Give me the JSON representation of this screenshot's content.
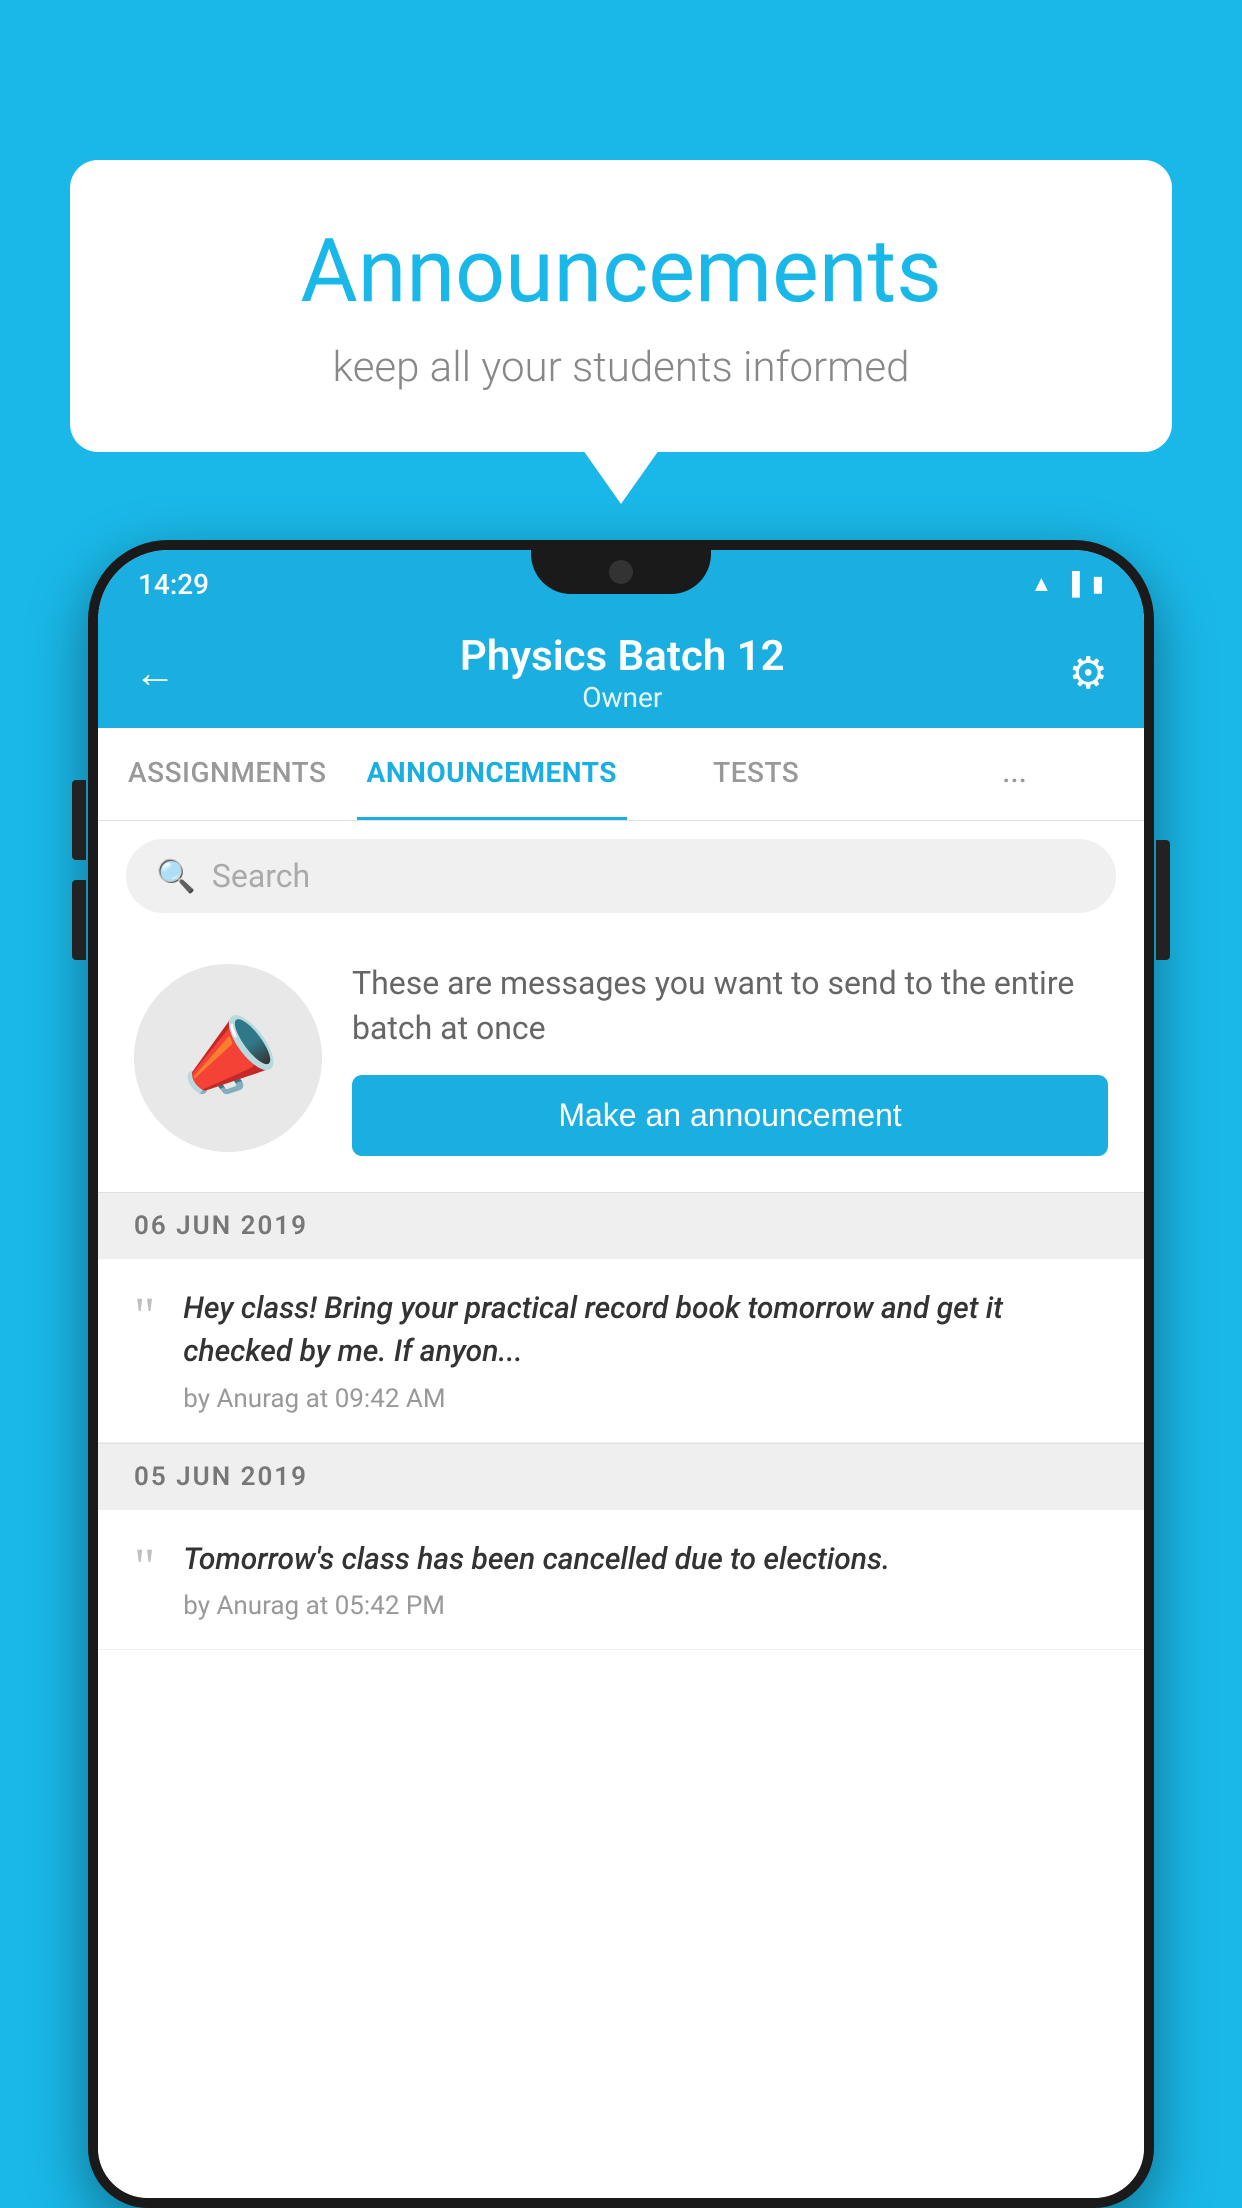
{
  "background_color": "#1ab8e8",
  "speech_bubble": {
    "title": "Announcements",
    "subtitle": "keep all your students informed"
  },
  "status_bar": {
    "time": "14:29",
    "icons": [
      "wifi",
      "signal",
      "battery"
    ]
  },
  "header": {
    "title": "Physics Batch 12",
    "subtitle": "Owner",
    "back_label": "←",
    "settings_label": "⚙"
  },
  "tabs": [
    {
      "label": "ASSIGNMENTS",
      "active": false
    },
    {
      "label": "ANNOUNCEMENTS",
      "active": true
    },
    {
      "label": "TESTS",
      "active": false
    },
    {
      "label": "...",
      "active": false
    }
  ],
  "search": {
    "placeholder": "Search"
  },
  "promo_card": {
    "description": "These are messages you want to send to the entire batch at once",
    "button_label": "Make an announcement"
  },
  "announcements": [
    {
      "date": "06  JUN  2019",
      "items": [
        {
          "text": "Hey class! Bring your practical record book tomorrow and get it checked by me. If anyon...",
          "author": "by Anurag at 09:42 AM"
        }
      ]
    },
    {
      "date": "05  JUN  2019",
      "items": [
        {
          "text": "Tomorrow's class has been cancelled due to elections.",
          "author": "by Anurag at 05:42 PM"
        }
      ]
    }
  ]
}
